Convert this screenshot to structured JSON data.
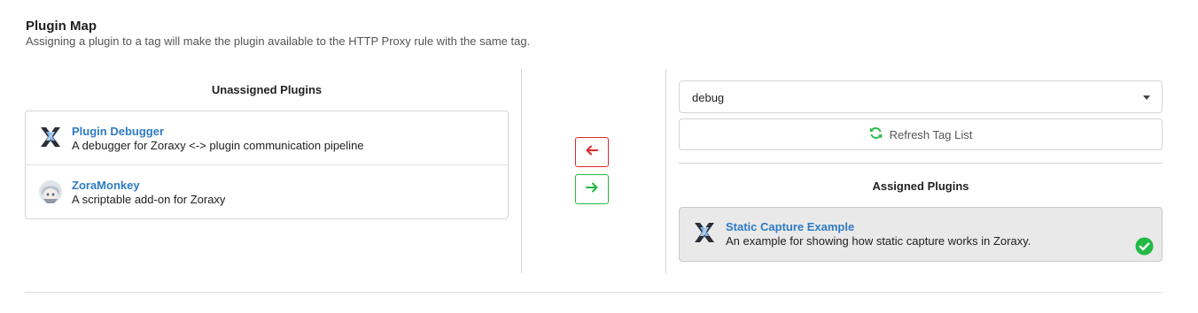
{
  "header": {
    "title": "Plugin Map",
    "subtitle": "Assigning a plugin to a tag will make the plugin available to the HTTP Proxy rule with the same tag."
  },
  "unassigned": {
    "title": "Unassigned Plugins",
    "items": [
      {
        "name": "Plugin Debugger",
        "description": "A debugger for Zoraxy <-> plugin communication pipeline",
        "icon": "zoraxy-x-icon"
      },
      {
        "name": "ZoraMonkey",
        "description": "A scriptable add-on for Zoraxy",
        "icon": "zoramonkey-avatar-icon"
      }
    ]
  },
  "actions": {
    "remove_icon": "arrow-left-icon",
    "add_icon": "arrow-right-icon",
    "remove_color": "#db2828",
    "add_color": "#21ba45"
  },
  "tag_selector": {
    "value": "debug",
    "refresh_label": "Refresh Tag List"
  },
  "assigned": {
    "title": "Assigned Plugins",
    "items": [
      {
        "name": "Static Capture Example",
        "description": "An example for showing how static capture works in Zoraxy.",
        "icon": "zoraxy-x-icon",
        "status": "enabled"
      }
    ]
  },
  "colors": {
    "link": "#2e7bc4",
    "check": "#21ba45"
  }
}
